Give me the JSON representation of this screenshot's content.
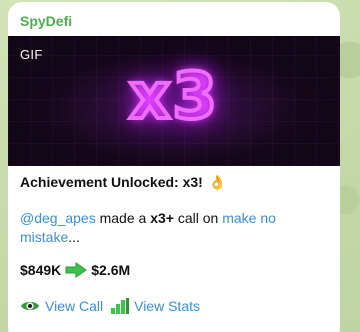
{
  "message": {
    "sender": "SpyDefi",
    "media": {
      "badge": "GIF",
      "neon_text": "x3"
    },
    "title": "Achievement Unlocked: x3!",
    "title_emoji": "👌",
    "body": {
      "mention": "@deg_apes",
      "text1": " made a ",
      "highlight": "x3+",
      "text2": " call on ",
      "link": "make no mistake",
      "ellipsis": "..."
    },
    "price": {
      "from": "$849K",
      "to": "$2.6M",
      "arrow_icon": "green-right-arrow-icon"
    },
    "actions": [
      {
        "label": "View Call",
        "icon": "eye-icon"
      },
      {
        "label": "View Stats",
        "icon": "bar-chart-icon"
      }
    ]
  },
  "colors": {
    "sender": "#4fae4e",
    "link": "#3a8fd6",
    "neon": "#f06cff",
    "arrow": "#3dc34a"
  }
}
